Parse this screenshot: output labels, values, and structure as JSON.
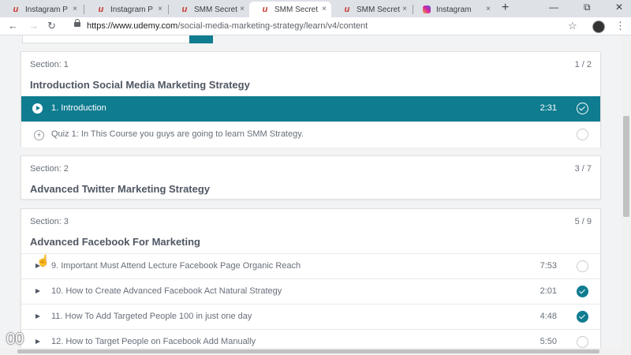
{
  "browser": {
    "tabs": [
      {
        "label": "Instagram P",
        "icon": "udemy-icon",
        "active": false
      },
      {
        "label": "Instagram P",
        "icon": "udemy-icon",
        "active": false
      },
      {
        "label": "SMM Secret",
        "icon": "udemy-icon",
        "active": false
      },
      {
        "label": "SMM Secret",
        "icon": "udemy-icon",
        "active": true
      },
      {
        "label": "SMM Secret",
        "icon": "udemy-icon",
        "active": false
      },
      {
        "label": "Instagram",
        "icon": "instagram-icon",
        "active": false
      }
    ],
    "close_glyph": "×",
    "new_tab_glyph": "+",
    "url_host": "https://www.udemy.com",
    "url_path": "/social-media-marketing-strategy/learn/v4/content"
  },
  "sections": [
    {
      "number": "Section: 1",
      "count": "1 / 2",
      "title": "Introduction Social Media Marketing Strategy",
      "lectures": [
        {
          "title": "1. Introduction",
          "duration": "2:31",
          "done": true,
          "active": true,
          "kind": "play"
        },
        {
          "title": "Quiz 1: In This Course you guys are going to learn SMM Strategy.",
          "duration": "",
          "done": false,
          "active": false,
          "kind": "quiz"
        }
      ]
    },
    {
      "number": "Section: 2",
      "count": "3 / 7",
      "title": "Advanced Twitter Marketing Strategy",
      "lectures": []
    },
    {
      "number": "Section: 3",
      "count": "5 / 9",
      "title": "Advanced Facebook For Marketing",
      "lectures": [
        {
          "title": "9. Important Must Attend Lecture Facebook Page Organic Reach",
          "duration": "7:53",
          "done": false,
          "active": false,
          "kind": "plain"
        },
        {
          "title": "10. How to Create Advanced Facebook Act Natural Strategy",
          "duration": "2:01",
          "done": true,
          "active": false,
          "kind": "plain"
        },
        {
          "title": "11. How To Add Targeted People 100 in just one day",
          "duration": "4:48",
          "done": true,
          "active": false,
          "kind": "plain"
        },
        {
          "title": "12. How to Target People on Facebook Add Manually",
          "duration": "5:50",
          "done": false,
          "active": false,
          "kind": "plain"
        }
      ]
    }
  ],
  "overlay": "00",
  "colors": {
    "accent": "#0f7c90"
  }
}
